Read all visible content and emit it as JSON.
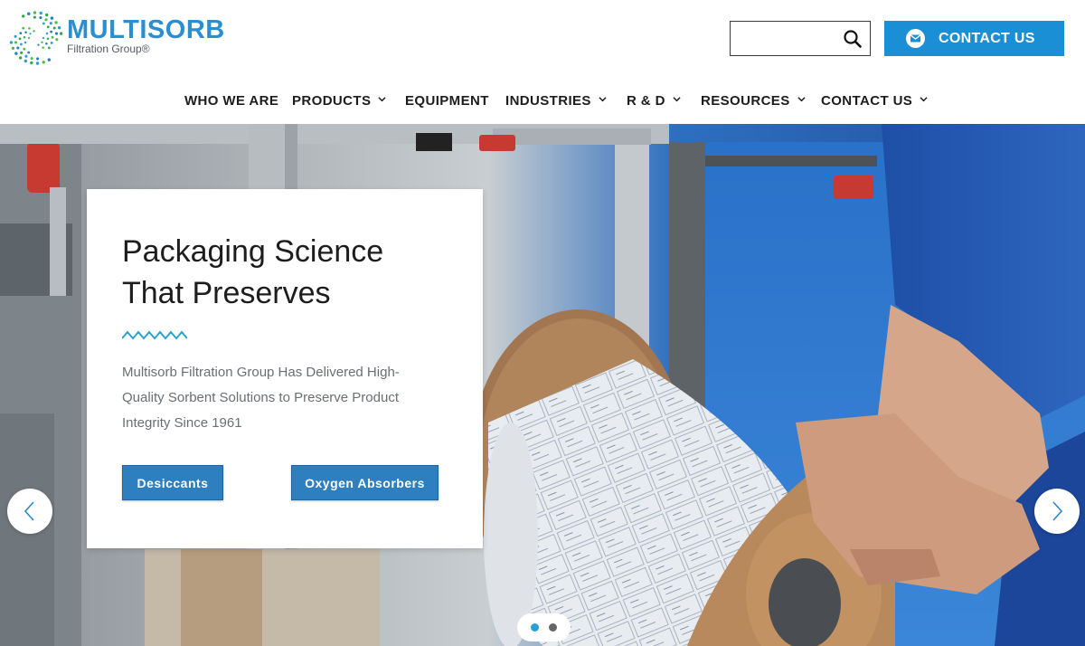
{
  "brand": {
    "name": "MULTISORB",
    "tagline": "Filtration Group®",
    "primary_color": "#1a8fd5",
    "logo_icon": "dotted-swirl-logo-icon"
  },
  "header": {
    "search": {
      "placeholder": "",
      "icon": "search-icon"
    },
    "contact_button": {
      "label": "CONTACT US",
      "icon": "mail-icon"
    }
  },
  "nav": {
    "items": [
      {
        "label": "WHO WE ARE",
        "has_dropdown": false
      },
      {
        "label": "PRODUCTS",
        "has_dropdown": true
      },
      {
        "label": "EQUIPMENT",
        "has_dropdown": false
      },
      {
        "label": "INDUSTRIES",
        "has_dropdown": true
      },
      {
        "label": "R & D",
        "has_dropdown": true
      },
      {
        "label": "RESOURCES",
        "has_dropdown": true
      },
      {
        "label": "CONTACT US",
        "has_dropdown": true
      }
    ]
  },
  "hero": {
    "title_line1": "Packaging Science",
    "title_line2": "That Preserves",
    "description": "Multisorb Filtration Group Has Delivered High-Quality Sorbent Solutions to Preserve Product Integrity Since 1961",
    "buttons": [
      {
        "label": "Desiccants"
      },
      {
        "label": "Oxygen Absorbers"
      }
    ],
    "carousel": {
      "slides": 2,
      "active_slide": 1,
      "prev_icon": "chevron-left-icon",
      "next_icon": "chevron-right-icon"
    },
    "accent_color": "#2e7fc0",
    "zigzag_color": "#2aa3d0"
  }
}
